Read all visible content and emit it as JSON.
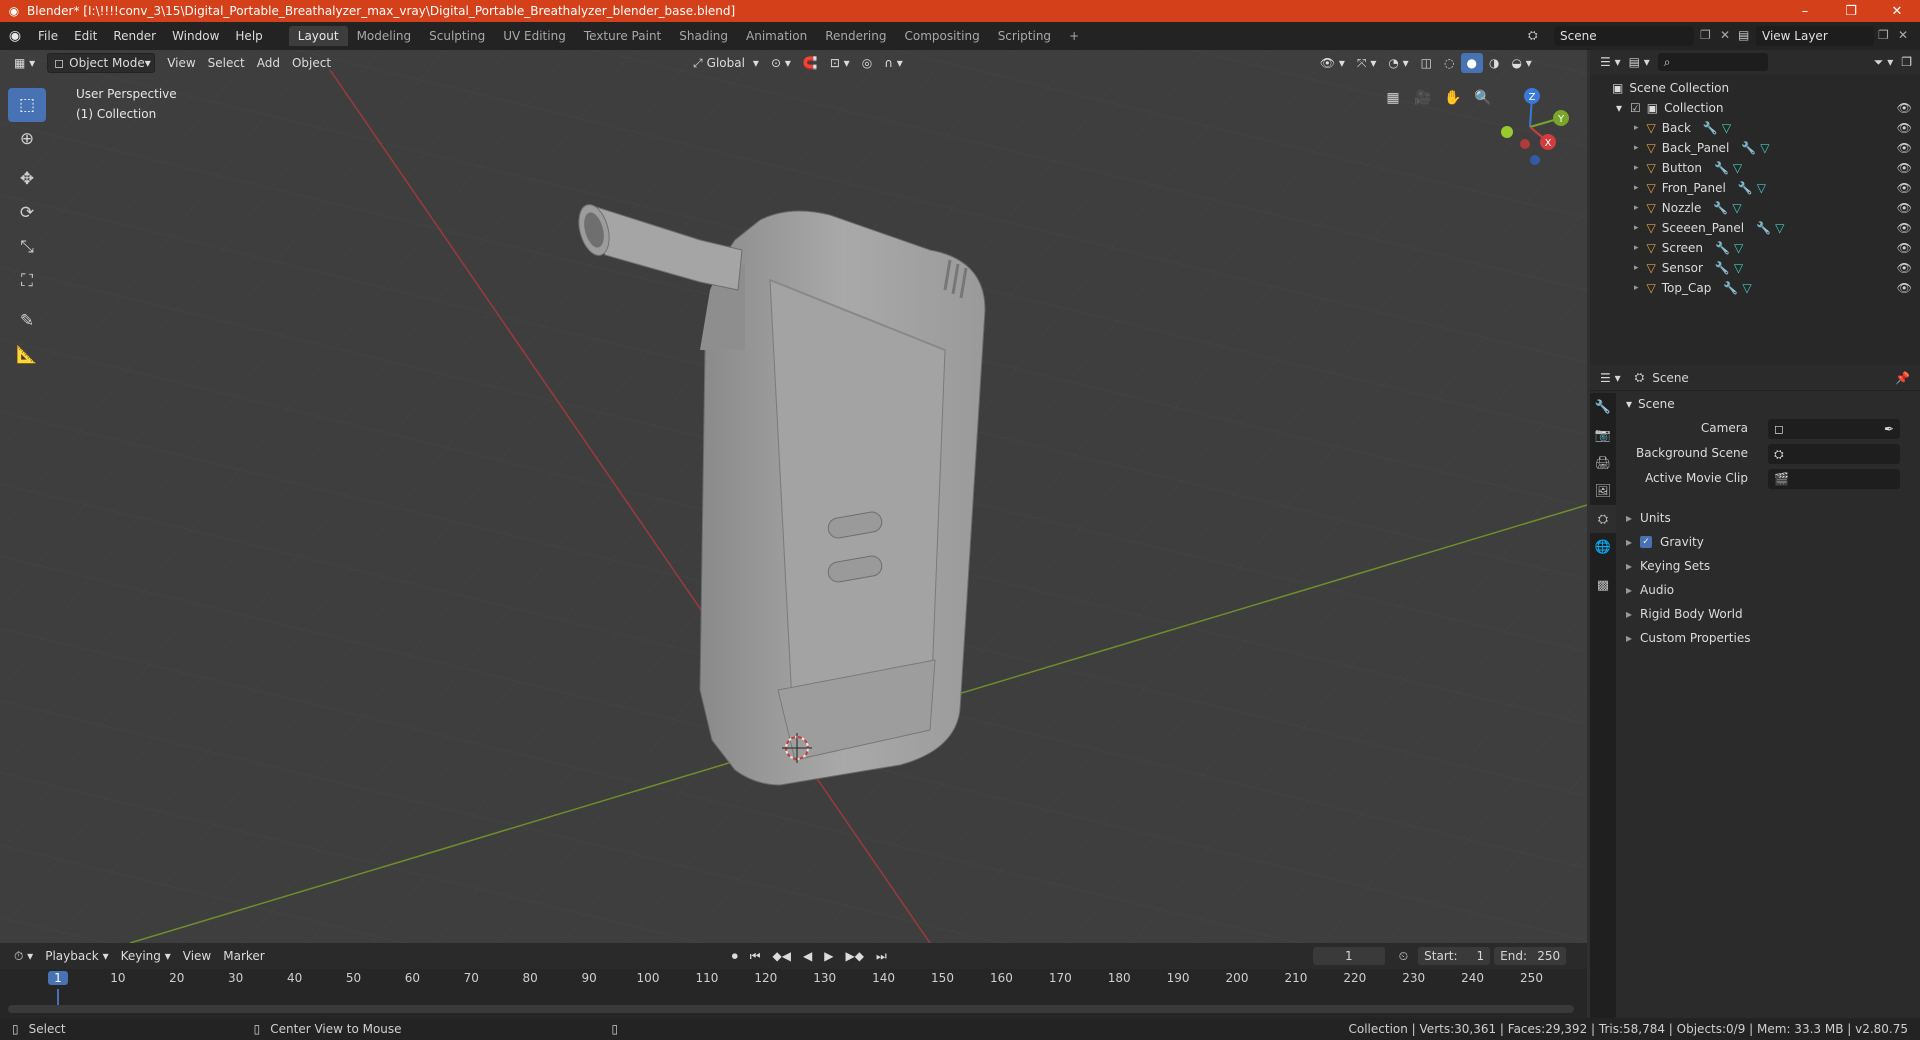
{
  "window": {
    "title": "Blender* [I:\\!!!!conv_3\\15\\Digital_Portable_Breathalyzer_max_vray\\Digital_Portable_Breathalyzer_blender_base.blend]",
    "minimize": "–",
    "maximize": "❐",
    "close": "✕"
  },
  "menu": [
    "File",
    "Edit",
    "Render",
    "Window",
    "Help"
  ],
  "workspaces": [
    "Layout",
    "Modeling",
    "Sculpting",
    "UV Editing",
    "Texture Paint",
    "Shading",
    "Animation",
    "Rendering",
    "Compositing",
    "Scripting"
  ],
  "active_workspace": "Layout",
  "add_workspace": "+",
  "scene_field": "Scene",
  "view_layer_field": "View Layer",
  "viewport": {
    "mode": "Object Mode",
    "menus": [
      "View",
      "Select",
      "Add",
      "Object"
    ],
    "transform_orientation": "Global",
    "overlay_line1": "User Perspective",
    "overlay_line2": "(1) Collection",
    "gizmo": {
      "z": "Z",
      "y": "Y",
      "x": "X"
    }
  },
  "outliner": {
    "search_placeholder": "",
    "root": "Scene Collection",
    "collection": "Collection",
    "objects": [
      "Back",
      "Back_Panel",
      "Button",
      "Fron_Panel",
      "Nozzle",
      "Sceeen_Panel",
      "Screen",
      "Sensor",
      "Top_Cap"
    ]
  },
  "properties": {
    "header": "Scene",
    "section": "Scene",
    "camera_label": "Camera",
    "background_label": "Background Scene",
    "movieclip_label": "Active Movie Clip",
    "subsections": [
      "Units",
      "Gravity",
      "Keying Sets",
      "Audio",
      "Rigid Body World",
      "Custom Properties"
    ],
    "gravity_checked": true
  },
  "timeline": {
    "menus": [
      "Playback",
      "Keying",
      "View",
      "Marker"
    ],
    "current_frame": "1",
    "start_label": "Start:",
    "start": "1",
    "end_label": "End:",
    "end": "250",
    "ruler": [
      "1",
      "10",
      "20",
      "30",
      "40",
      "50",
      "60",
      "70",
      "80",
      "90",
      "100",
      "110",
      "120",
      "130",
      "140",
      "150",
      "160",
      "170",
      "180",
      "190",
      "200",
      "210",
      "220",
      "230",
      "240",
      "250"
    ]
  },
  "status": {
    "left": "Select",
    "middle": "Center View to Mouse",
    "right": "Collection | Verts:30,361 | Faces:29,392 | Tris:58,784 | Objects:0/9 | Mem: 33.3 MB | v2.80.75"
  },
  "colors": {
    "titlebar": "#d4401a",
    "accent": "#4772b3",
    "x_axis": "#c33b3b",
    "y_axis": "#7aa52a",
    "object_icon": "#e8a044",
    "mesh_icon": "#3fd0c0"
  }
}
